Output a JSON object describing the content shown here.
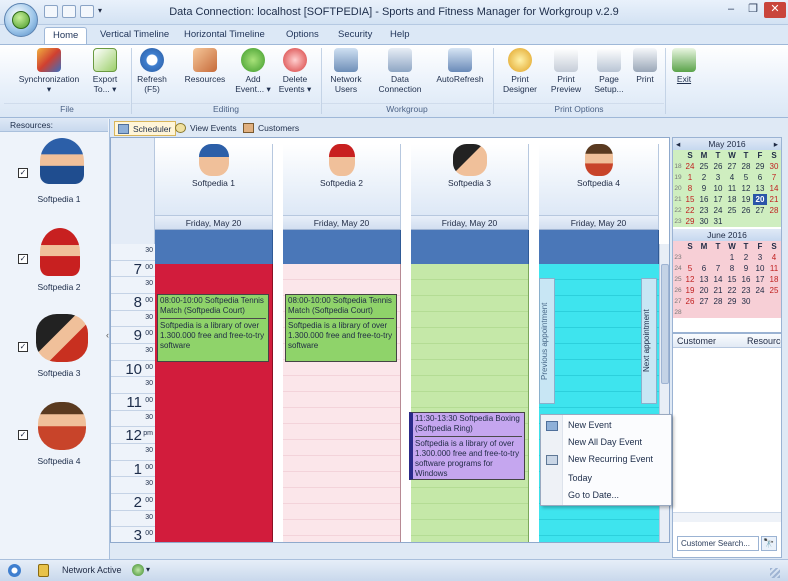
{
  "window": {
    "title": "Data Connection: localhost [SOFTPEDIA] - Sports and Fitness Manager for Workgroup v.2.9",
    "controls": {
      "minimize": "–",
      "restore": "❐",
      "close": "✕"
    }
  },
  "ribbon_tabs": [
    "Home",
    "Vertical Timeline",
    "Horizontal Timeline",
    "Options",
    "Security",
    "Help"
  ],
  "ribbon": {
    "file_group": {
      "label": "File",
      "buttons": [
        {
          "label": "Synchronization",
          "sub": "▾",
          "icon": "sync-icon"
        },
        {
          "label": "Export",
          "sub": "To... ▾",
          "icon": "export-icon"
        }
      ]
    },
    "editing_group": {
      "label": "Editing",
      "buttons": [
        {
          "label": "Refresh",
          "sub": "(F5)",
          "icon": "refresh-icon"
        },
        {
          "label": "Resources",
          "sub": "",
          "icon": "resources-icon"
        },
        {
          "label": "Add",
          "sub": "Event... ▾",
          "icon": "add-icon"
        },
        {
          "label": "Delete",
          "sub": "Events ▾",
          "icon": "delete-icon"
        }
      ]
    },
    "workgroup_group": {
      "label": "Workgroup",
      "buttons": [
        {
          "label": "Network",
          "sub": "Users",
          "icon": "network-users-icon"
        },
        {
          "label": "Data",
          "sub": "Connection",
          "icon": "data-connection-icon"
        },
        {
          "label": "AutoRefresh",
          "sub": "",
          "icon": "autorefresh-icon"
        }
      ]
    },
    "print_group": {
      "label": "Print Options",
      "buttons": [
        {
          "label": "Print",
          "sub": "Designer",
          "icon": "print-designer-icon"
        },
        {
          "label": "Print",
          "sub": "Preview",
          "icon": "print-preview-icon"
        },
        {
          "label": "Page",
          "sub": "Setup...",
          "icon": "page-setup-icon"
        },
        {
          "label": "Print",
          "sub": "",
          "icon": "printer-icon"
        }
      ]
    },
    "exit_button": {
      "label": "Exit",
      "icon": "exit-icon"
    }
  },
  "resources_panel": {
    "header": "Resources:",
    "items": [
      {
        "label": "Softpedia 1",
        "checked": "✓"
      },
      {
        "label": "Softpedia 2",
        "checked": "✓"
      },
      {
        "label": "Softpedia 3",
        "checked": "✓"
      },
      {
        "label": "Softpedia 4",
        "checked": "✓"
      }
    ]
  },
  "view_tabs": [
    "Scheduler",
    "View Events",
    "Customers"
  ],
  "scheduler": {
    "columns": [
      {
        "resource": "Softpedia 1",
        "date": "Friday, May 20",
        "color": "#d21c3c"
      },
      {
        "resource": "Softpedia 2",
        "date": "Friday, May 20",
        "color": "#fbe6ea"
      },
      {
        "resource": "Softpedia 3",
        "date": "Friday, May 20",
        "color": "#c5e8a8"
      },
      {
        "resource": "Softpedia 4",
        "date": "Friday, May 20",
        "color": "#3ee4ee"
      }
    ],
    "time_rows": [
      {
        "hour": "",
        "min": "30"
      },
      {
        "hour": "7",
        "min": "00"
      },
      {
        "hour": "",
        "min": "30"
      },
      {
        "hour": "8",
        "min": "00"
      },
      {
        "hour": "",
        "min": "30"
      },
      {
        "hour": "9",
        "min": "00"
      },
      {
        "hour": "",
        "min": "30"
      },
      {
        "hour": "10",
        "min": "00"
      },
      {
        "hour": "",
        "min": "30"
      },
      {
        "hour": "11",
        "min": "00"
      },
      {
        "hour": "",
        "min": "30"
      },
      {
        "hour": "12",
        "min": "pm"
      },
      {
        "hour": "",
        "min": "30"
      },
      {
        "hour": "1",
        "min": "00"
      },
      {
        "hour": "",
        "min": "30"
      },
      {
        "hour": "2",
        "min": "00"
      },
      {
        "hour": "",
        "min": "30"
      },
      {
        "hour": "3",
        "min": "00"
      }
    ],
    "appointments": {
      "a1": {
        "time": "08:00-10:00 Softpedia Tennis Match (Softpedia Court)",
        "body": "Softpedia is a library of over 1.300.000 free and free-to-try software"
      },
      "a2": {
        "time": "08:00-10:00 Softpedia Tennis Match (Softpedia Court)",
        "body": "Softpedia is a library of over 1.300.000 free and free-to-try software"
      },
      "a3": {
        "time": "11:30-13:30 Softpedia Boxing (Softpedia Ring)",
        "body": "Softpedia is a library of over 1.300.000 free and free-to-try software programs for Windows"
      }
    },
    "prev_appointment": "Previous appointment",
    "next_appointment": "Next appointment"
  },
  "context_menu": [
    "New Event",
    "New All Day Event",
    "New Recurring Event",
    "Today",
    "Go to Date..."
  ],
  "mini_calendar": {
    "weekdays": [
      "S",
      "M",
      "T",
      "W",
      "T",
      "F",
      "S"
    ],
    "may": {
      "title": "May 2016",
      "weeks": [
        {
          "wk": "18",
          "days": [
            "24",
            "25",
            "26",
            "27",
            "28",
            "29",
            "30"
          ]
        },
        {
          "wk": "19",
          "days": [
            "1",
            "2",
            "3",
            "4",
            "5",
            "6",
            "7"
          ]
        },
        {
          "wk": "20",
          "days": [
            "8",
            "9",
            "10",
            "11",
            "12",
            "13",
            "14"
          ]
        },
        {
          "wk": "21",
          "days": [
            "15",
            "16",
            "17",
            "18",
            "19",
            "20",
            "21"
          ]
        },
        {
          "wk": "22",
          "days": [
            "22",
            "23",
            "24",
            "25",
            "26",
            "27",
            "28"
          ]
        },
        {
          "wk": "23",
          "days": [
            "29",
            "30",
            "31",
            "",
            "",
            "",
            ""
          ]
        }
      ]
    },
    "june": {
      "title": "June 2016",
      "weeks": [
        {
          "wk": "23",
          "days": [
            "",
            "",
            "",
            "1",
            "2",
            "3",
            "4"
          ]
        },
        {
          "wk": "24",
          "days": [
            "5",
            "6",
            "7",
            "8",
            "9",
            "10",
            "11"
          ]
        },
        {
          "wk": "25",
          "days": [
            "12",
            "13",
            "14",
            "15",
            "16",
            "17",
            "18"
          ]
        },
        {
          "wk": "26",
          "days": [
            "19",
            "20",
            "21",
            "22",
            "23",
            "24",
            "25"
          ]
        },
        {
          "wk": "27",
          "days": [
            "26",
            "27",
            "28",
            "29",
            "30",
            "",
            ""
          ]
        },
        {
          "wk": "28",
          "days": [
            "",
            "",
            "",
            "",
            "",
            "",
            ""
          ]
        }
      ]
    },
    "selected_day": "20"
  },
  "customer_panel": {
    "col_customer": "Customer",
    "col_resource": "Resource",
    "search_placeholder": "Customer Search...",
    "search_button": "🔭"
  },
  "statusbar": {
    "network_status": "Network Active"
  }
}
